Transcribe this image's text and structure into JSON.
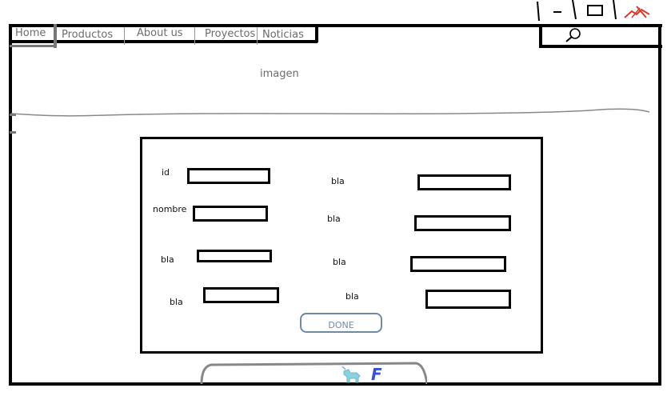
{
  "nav": {
    "items": [
      {
        "label": "Home"
      },
      {
        "label": "Productos"
      },
      {
        "label": "About us"
      },
      {
        "label": "Proyectos"
      },
      {
        "label": "Noticias"
      }
    ]
  },
  "search": {
    "icon": "search-icon"
  },
  "window_controls": {
    "minimize_icon": "minimize-icon",
    "maximize_icon": "maximize-icon",
    "close_icon": "close-icon"
  },
  "banner": {
    "label": "imagen"
  },
  "form": {
    "left_fields": [
      {
        "label": "id"
      },
      {
        "label": "nombre"
      },
      {
        "label": "bla"
      },
      {
        "label": "bla"
      }
    ],
    "right_fields": [
      {
        "label": "bla"
      },
      {
        "label": "bla"
      },
      {
        "label": "bla"
      },
      {
        "label": "bla"
      }
    ],
    "done_label": "DONE"
  },
  "footer": {
    "icons": [
      "unicorn-icon",
      "facebook-icon"
    ],
    "facebook_letter": "F"
  },
  "colors": {
    "frame": "#000000",
    "nav_text": "#6c6c6c",
    "done_border": "#6f8aa6",
    "facebook_blue": "#3b4fd1",
    "unicorn_blue": "#8fd0e0",
    "close_red": "#d83a2a"
  }
}
